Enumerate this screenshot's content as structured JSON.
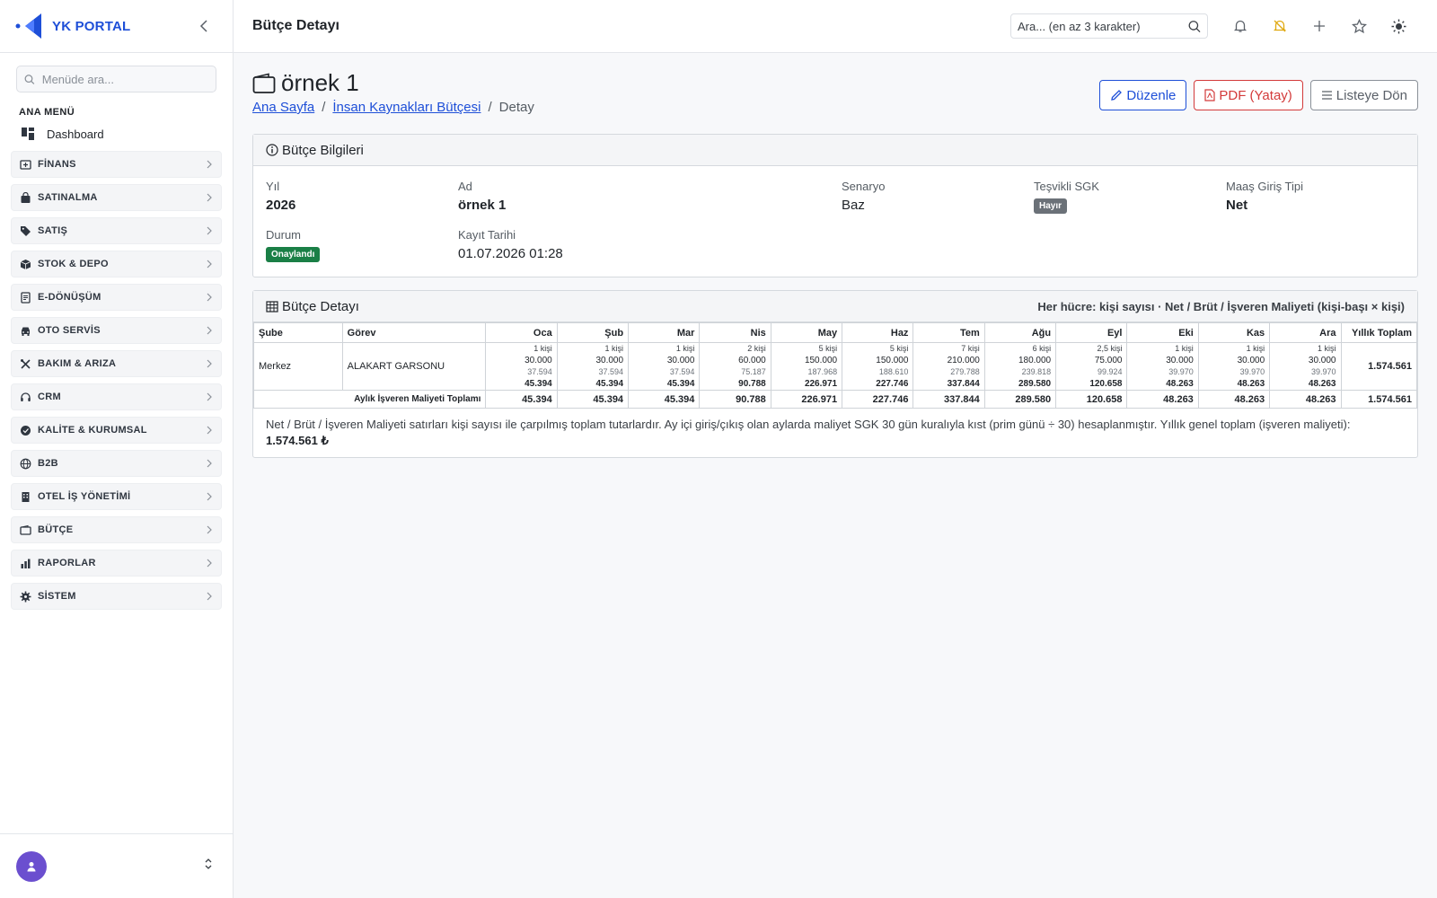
{
  "brand": {
    "name": "YK PORTAL"
  },
  "sidebar": {
    "search_placeholder": "Menüde ara...",
    "section_title": "ANA MENÜ",
    "dashboard_label": "Dashboard",
    "items": [
      {
        "label": "FİNANS",
        "icon": "finance-icon"
      },
      {
        "label": "SATINALMA",
        "icon": "shopping-bag-icon"
      },
      {
        "label": "SATIŞ",
        "icon": "tag-icon"
      },
      {
        "label": "STOK & DEPO",
        "icon": "box-icon"
      },
      {
        "label": "E-DÖNÜŞÜM",
        "icon": "document-icon"
      },
      {
        "label": "OTO SERVİS",
        "icon": "car-icon"
      },
      {
        "label": "BAKIM & ARIZA",
        "icon": "tools-icon"
      },
      {
        "label": "CRM",
        "icon": "headset-icon"
      },
      {
        "label": "KALİTE & KURUMSAL",
        "icon": "badge-icon"
      },
      {
        "label": "B2B",
        "icon": "globe-icon"
      },
      {
        "label": "OTEL İŞ YÖNETİMİ",
        "icon": "building-icon"
      },
      {
        "label": "BÜTÇE",
        "icon": "wallet-icon"
      },
      {
        "label": "RAPORLAR",
        "icon": "bar-chart-icon"
      },
      {
        "label": "SİSTEM",
        "icon": "gear-icon"
      }
    ]
  },
  "topbar": {
    "title": "Bütçe Detayı",
    "search_placeholder": "Ara... (en az 3 karakter)"
  },
  "page": {
    "title": "örnek 1",
    "breadcrumb": {
      "home": "Ana Sayfa",
      "parent": "İnsan Kaynakları Bütçesi",
      "current": "Detay"
    },
    "actions": {
      "edit": "Düzenle",
      "pdf": "PDF (Yatay)",
      "back": "Listeye Dön"
    }
  },
  "info": {
    "header": "Bütçe Bilgileri",
    "year_label": "Yıl",
    "year": "2026",
    "name_label": "Ad",
    "name": "örnek 1",
    "scenario_label": "Senaryo",
    "scenario": "Baz",
    "sgk_label": "Teşvikli SGK",
    "sgk": "Hayır",
    "salary_label": "Maaş Giriş Tipi",
    "salary": "Net",
    "status_label": "Durum",
    "status": "Onaylandı",
    "date_label": "Kayıt Tarihi",
    "date": "01.07.2026 01:28"
  },
  "detail": {
    "header": "Bütçe Detayı",
    "note": "Her hücre: kişi sayısı · Net / Brüt / İşveren Maliyeti (kişi-başı × kişi)",
    "col_branch": "Şube",
    "col_role": "Görev",
    "months": [
      "Oca",
      "Şub",
      "Mar",
      "Nis",
      "May",
      "Haz",
      "Tem",
      "Ağu",
      "Eyl",
      "Eki",
      "Kas",
      "Ara"
    ],
    "col_total": "Yıllık Toplam",
    "row": {
      "branch": "Merkez",
      "role": "ALAKART GARSONU",
      "cells": [
        {
          "p": "1 kişi",
          "n": "30.000",
          "g": "37.594",
          "e": "45.394"
        },
        {
          "p": "1 kişi",
          "n": "30.000",
          "g": "37.594",
          "e": "45.394"
        },
        {
          "p": "1 kişi",
          "n": "30.000",
          "g": "37.594",
          "e": "45.394"
        },
        {
          "p": "2 kişi",
          "n": "60.000",
          "g": "75.187",
          "e": "90.788"
        },
        {
          "p": "5 kişi",
          "n": "150.000",
          "g": "187.968",
          "e": "226.971"
        },
        {
          "p": "5 kişi",
          "n": "150.000",
          "g": "188.610",
          "e": "227.746"
        },
        {
          "p": "7 kişi",
          "n": "210.000",
          "g": "279.788",
          "e": "337.844"
        },
        {
          "p": "6 kişi",
          "n": "180.000",
          "g": "239.818",
          "e": "289.580"
        },
        {
          "p": "2,5 kişi",
          "n": "75.000",
          "g": "99.924",
          "e": "120.658"
        },
        {
          "p": "1 kişi",
          "n": "30.000",
          "g": "39.970",
          "e": "48.263"
        },
        {
          "p": "1 kişi",
          "n": "30.000",
          "g": "39.970",
          "e": "48.263"
        },
        {
          "p": "1 kişi",
          "n": "30.000",
          "g": "39.970",
          "e": "48.263"
        }
      ],
      "total": "1.574.561"
    },
    "total_row_label": "Aylık İşveren Maliyeti Toplamı",
    "monthly_totals": [
      "45.394",
      "45.394",
      "45.394",
      "90.788",
      "226.971",
      "227.746",
      "337.844",
      "289.580",
      "120.658",
      "48.263",
      "48.263",
      "48.263"
    ],
    "grand_total": "1.574.561",
    "footnote_text": "Net / Brüt / İşveren Maliyeti satırları kişi sayısı ile çarpılmış toplam tutarlardır. Ay içi giriş/çıkış olan aylarda maliyet SGK 30 gün kuralıyla kıst (prim günü ÷ 30) hesaplanmıştır. Yıllık genel toplam (işveren maliyeti): ",
    "footnote_total": "1.574.561 ₺"
  },
  "colors": {
    "accent": "#1e4fd8",
    "danger": "#d33a3a",
    "success": "#1a7f46",
    "avatar": "#6b4fcf",
    "warning_icon": "#e0a80f"
  }
}
